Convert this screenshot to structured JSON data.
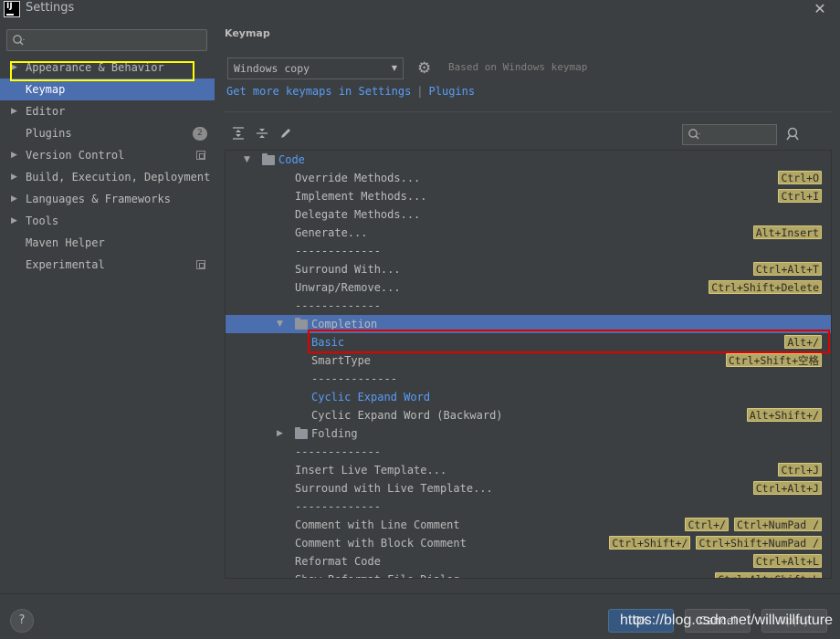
{
  "window": {
    "title": "Settings",
    "app_icon_text": "IJ"
  },
  "sidebar": {
    "search_placeholder": "",
    "items": [
      {
        "label": "Appearance & Behavior",
        "expandable": true
      },
      {
        "label": "Keymap",
        "selected": true
      },
      {
        "label": "Editor",
        "expandable": true
      },
      {
        "label": "Plugins",
        "badge": "2"
      },
      {
        "label": "Version Control",
        "expandable": true,
        "project_icon": true
      },
      {
        "label": "Build, Execution, Deployment",
        "expandable": true
      },
      {
        "label": "Languages & Frameworks",
        "expandable": true
      },
      {
        "label": "Tools",
        "expandable": true
      },
      {
        "label": "Maven Helper"
      },
      {
        "label": "Experimental",
        "project_icon": true
      }
    ]
  },
  "main": {
    "title": "Keymap",
    "keymap_select": "Windows copy",
    "based_on": "Based on Windows keymap",
    "links": {
      "prefix": "Get more keymaps in Settings",
      "separator": "|",
      "plugins": "Plugins"
    },
    "filter_placeholder": ""
  },
  "tree": [
    {
      "label": "Code",
      "kind": "folder",
      "indent": 0,
      "expanded": true,
      "blue": true,
      "shortcuts": []
    },
    {
      "label": "Override Methods...",
      "indent": 1,
      "shortcuts": [
        "Ctrl+O"
      ]
    },
    {
      "label": "Implement Methods...",
      "indent": 1,
      "shortcuts": [
        "Ctrl+I"
      ]
    },
    {
      "label": "Delegate Methods...",
      "indent": 1,
      "shortcuts": []
    },
    {
      "label": "Generate...",
      "indent": 1,
      "shortcuts": [
        "Alt+Insert"
      ]
    },
    {
      "label": "-------------",
      "indent": 1,
      "shortcuts": []
    },
    {
      "label": "Surround With...",
      "indent": 1,
      "shortcuts": [
        "Ctrl+Alt+T"
      ]
    },
    {
      "label": "Unwrap/Remove...",
      "indent": 1,
      "shortcuts": [
        "Ctrl+Shift+Delete"
      ]
    },
    {
      "label": "-------------",
      "indent": 1,
      "shortcuts": []
    },
    {
      "label": "Completion",
      "kind": "folder",
      "indent": 1,
      "expanded": true,
      "selected": true,
      "shortcuts": []
    },
    {
      "label": "Basic",
      "indent": 2,
      "blue": true,
      "shortcuts": [
        "Alt+/"
      ]
    },
    {
      "label": "SmartType",
      "indent": 2,
      "shortcuts": [
        "Ctrl+Shift+空格"
      ]
    },
    {
      "label": "-------------",
      "indent": 2,
      "shortcuts": []
    },
    {
      "label": "Cyclic Expand Word",
      "indent": 2,
      "blue": true,
      "shortcuts": []
    },
    {
      "label": "Cyclic Expand Word (Backward)",
      "indent": 2,
      "shortcuts": [
        "Alt+Shift+/"
      ]
    },
    {
      "label": "Folding",
      "kind": "folder",
      "indent": 1,
      "expanded": false,
      "shortcuts": []
    },
    {
      "label": "-------------",
      "indent": 1,
      "shortcuts": []
    },
    {
      "label": "Insert Live Template...",
      "indent": 1,
      "shortcuts": [
        "Ctrl+J"
      ]
    },
    {
      "label": "Surround with Live Template...",
      "indent": 1,
      "shortcuts": [
        "Ctrl+Alt+J"
      ]
    },
    {
      "label": "-------------",
      "indent": 1,
      "shortcuts": []
    },
    {
      "label": "Comment with Line Comment",
      "indent": 1,
      "shortcuts": [
        "Ctrl+/",
        "Ctrl+NumPad /"
      ]
    },
    {
      "label": "Comment with Block Comment",
      "indent": 1,
      "shortcuts": [
        "Ctrl+Shift+/",
        "Ctrl+Shift+NumPad /"
      ]
    },
    {
      "label": "Reformat Code",
      "indent": 1,
      "shortcuts": [
        "Ctrl+Alt+L"
      ]
    },
    {
      "label": "Show Reformat File Dialog",
      "indent": 1,
      "shortcuts": [
        "Ctrl+Alt+Shift+L"
      ]
    }
  ],
  "footer": {
    "help": "?",
    "ok": "OK",
    "cancel": "Cancel",
    "apply": "Apply",
    "watermark": "https://blog.csdn.net/willwillfuture"
  },
  "colors": {
    "background": "#3c3f41",
    "selection": "#4b6eaf",
    "link": "#589df6",
    "shortcut_bg": "#b3a764",
    "highlight_yellow": "#ffff00",
    "highlight_red": "#e00000"
  }
}
